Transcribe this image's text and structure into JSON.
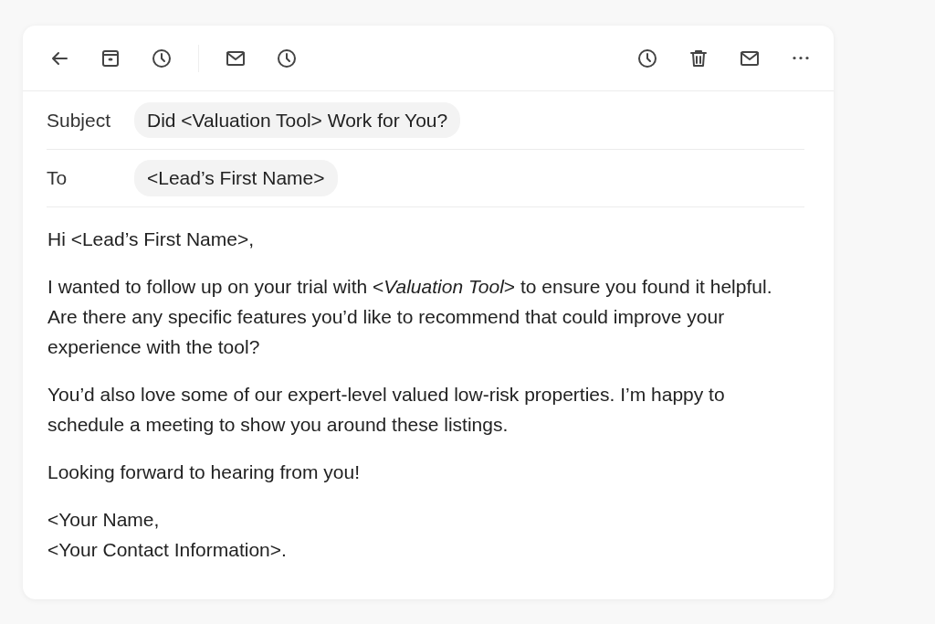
{
  "toolbar": {
    "left": [
      {
        "kind": "back"
      },
      {
        "kind": "archive"
      },
      {
        "kind": "clock"
      },
      {
        "kind": "divider"
      },
      {
        "kind": "mail"
      },
      {
        "kind": "clock"
      }
    ],
    "right": [
      {
        "kind": "clock"
      },
      {
        "kind": "trash"
      },
      {
        "kind": "mail"
      },
      {
        "kind": "more"
      }
    ]
  },
  "fields": [
    {
      "label": "Subject",
      "value": "Did <Valuation Tool> Work for You?"
    },
    {
      "label": "To",
      "value": "<Lead’s First Name>"
    }
  ],
  "body": [
    "Hi <Lead’s First Name>,",
    "I wanted to follow up on your trial with <*Valuation Tool*> to ensure you found it helpful. Are there any specific features you’d like to recommend that could improve your experience with the tool?",
    "You’d also love some of our expert-level valued low-risk properties. I’m happy to schedule a meeting to show you around these listings.",
    "Looking forward to hearing from you!"
  ],
  "signature": [
    "<Your Name,",
    "<Your Contact Information>."
  ]
}
